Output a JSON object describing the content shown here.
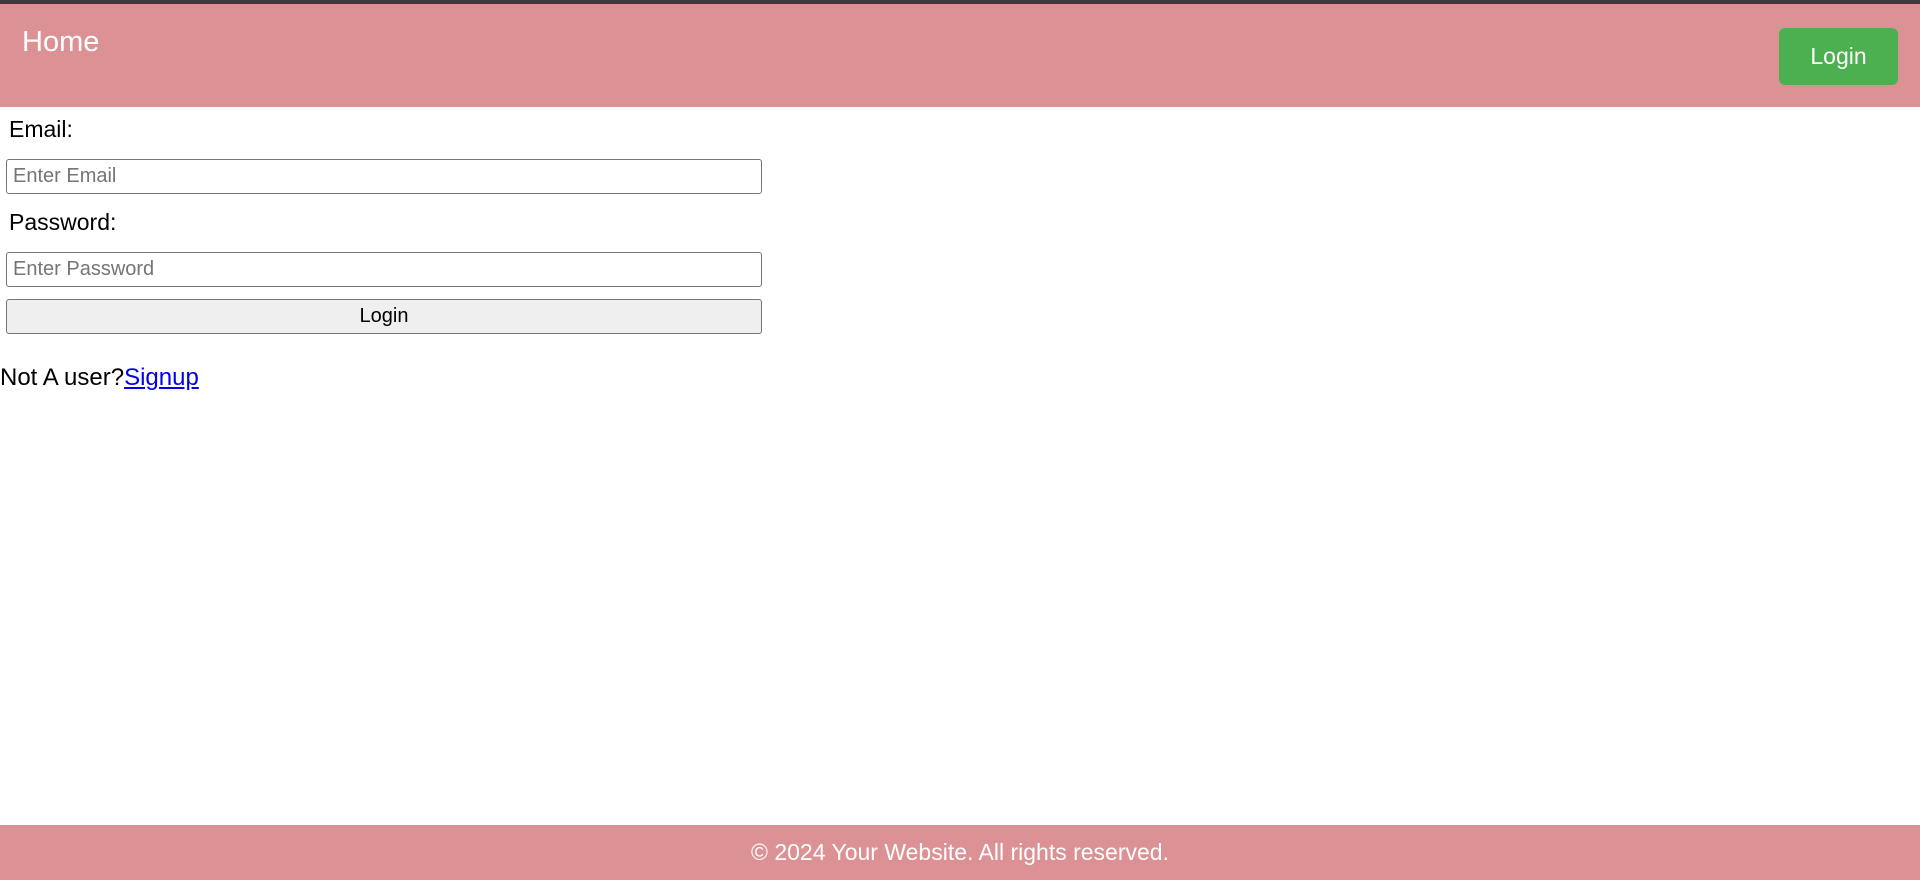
{
  "header": {
    "home_label": "Home",
    "login_label": "Login",
    "background_color": "#dc9294",
    "login_button_color": "#4caf50"
  },
  "form": {
    "email_label": "Email:",
    "email_placeholder": "Enter Email",
    "email_value": "",
    "password_label": "Password:",
    "password_placeholder": "Enter Password",
    "password_value": "",
    "submit_label": "Login"
  },
  "signup": {
    "prompt": "Not A user?",
    "link_label": "Signup"
  },
  "footer": {
    "text": "© 2024 Your Website. All rights reserved.",
    "background_color": "#dc9294"
  }
}
